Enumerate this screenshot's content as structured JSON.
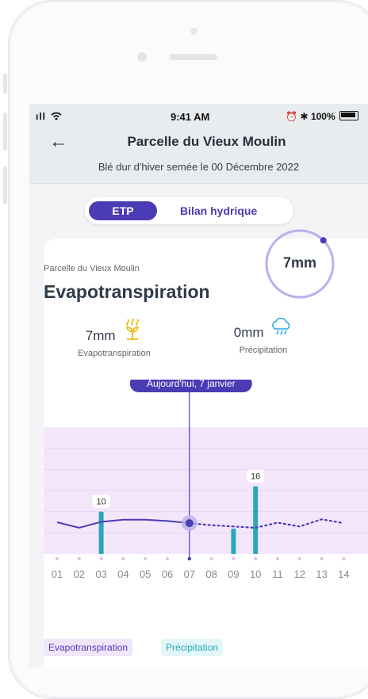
{
  "status_bar": {
    "signal": "ıll",
    "time": "9:41 AM",
    "battery": "100%"
  },
  "header": {
    "title": "Parcelle du Vieux Moulin",
    "subtitle": "Blé dur d'hiver semée le 00 Décembre 2022"
  },
  "tabs": {
    "active": "ETP",
    "other": "Bilan hydrique"
  },
  "card": {
    "parcel": "Parcelle du Vieux Moulin",
    "title": "Evapotranspiration",
    "gauge_value": "7mm",
    "gauge_fraction": 0.45
  },
  "stats": [
    {
      "value": "7mm",
      "label": "Evapotranspiration",
      "icon": "evapotranspiration-icon"
    },
    {
      "value": "0mm",
      "label": "Précipitation",
      "icon": "rain-cloud-icon"
    }
  ],
  "today_label": "Aujourd'hui, 7 janvier",
  "colors": {
    "accent": "#4b3bb4",
    "chart_band": "#f3e6fb",
    "precip": "#2aa8b8",
    "gauge_track": "#b9b0ec"
  },
  "chart_data": {
    "type": "line",
    "x": [
      "01",
      "02",
      "03",
      "04",
      "05",
      "06",
      "07",
      "08",
      "09",
      "10",
      "11",
      "12",
      "13",
      "14"
    ],
    "today_index": 6,
    "series": [
      {
        "name": "Evapotranspiration",
        "style": "solid",
        "values": [
          7.5,
          6.2,
          7.6,
          8.1,
          8.1,
          7.8,
          7.3,
          null,
          null,
          null,
          null,
          null,
          null,
          null
        ]
      },
      {
        "name": "Evapotranspiration",
        "style": "dotted",
        "values": [
          null,
          null,
          null,
          null,
          null,
          null,
          7.3,
          6.8,
          6.5,
          6.2,
          7.4,
          6.5,
          8.2,
          7.3
        ]
      },
      {
        "name": "Précipitation",
        "type": "bar",
        "values": [
          0,
          0,
          10,
          0,
          0,
          0,
          0,
          0,
          6,
          16,
          0,
          0,
          0,
          0
        ]
      }
    ],
    "data_labels": [
      {
        "x": "03",
        "text": "10"
      },
      {
        "x": "10",
        "text": "16"
      }
    ],
    "ylim": [
      0,
      30
    ]
  },
  "legend": [
    "Evapotranspiration",
    "Précipitation"
  ]
}
